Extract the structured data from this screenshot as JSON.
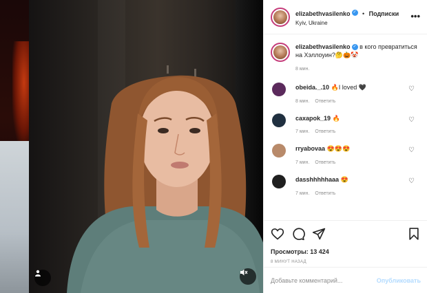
{
  "post": {
    "username": "elizabethvasilenko",
    "follow_label": "Подписки",
    "separator": "•",
    "location": "Kyiv, Ukraine",
    "caption": "в кого превратиться на Хэллоуин?🤔🎃🤡",
    "caption_time": "8 мин."
  },
  "comments": [
    {
      "user": "obeida._.10",
      "text": "🔥I loved 🖤",
      "time": "8 мин.",
      "reply": "Ответить",
      "avatar_color": "#5b2a5c"
    },
    {
      "user": "caxapok_19",
      "text": "🔥",
      "time": "7 мин.",
      "reply": "Ответить",
      "avatar_color": "#203040"
    },
    {
      "user": "rryabovaa",
      "text": "😍😍😍",
      "time": "7 мин.",
      "reply": "Ответить",
      "avatar_color": "#b88a6a"
    },
    {
      "user": "dasshhhhhaaa",
      "text": "😍",
      "time": "7 мин.",
      "reply": "Ответить",
      "avatar_color": "#1f1f1f"
    }
  ],
  "stats": {
    "views": "Просмотры: 13 424",
    "ago": "8 МИНУТ НАЗАД"
  },
  "add_comment": {
    "placeholder": "Добавьте комментарий...",
    "publish_label": "Опубликовать"
  },
  "icons": {
    "verified": "verified-badge-icon",
    "more": "more-options-icon",
    "heart": "heart-icon",
    "comment": "comment-icon",
    "share": "share-icon",
    "save": "bookmark-icon",
    "user_tag": "user-tag-icon",
    "mute": "mute-icon"
  },
  "colors": {
    "verified": "#3897f0",
    "publish_disabled": "#b3dbff",
    "story_ring": "#c53c7a"
  }
}
